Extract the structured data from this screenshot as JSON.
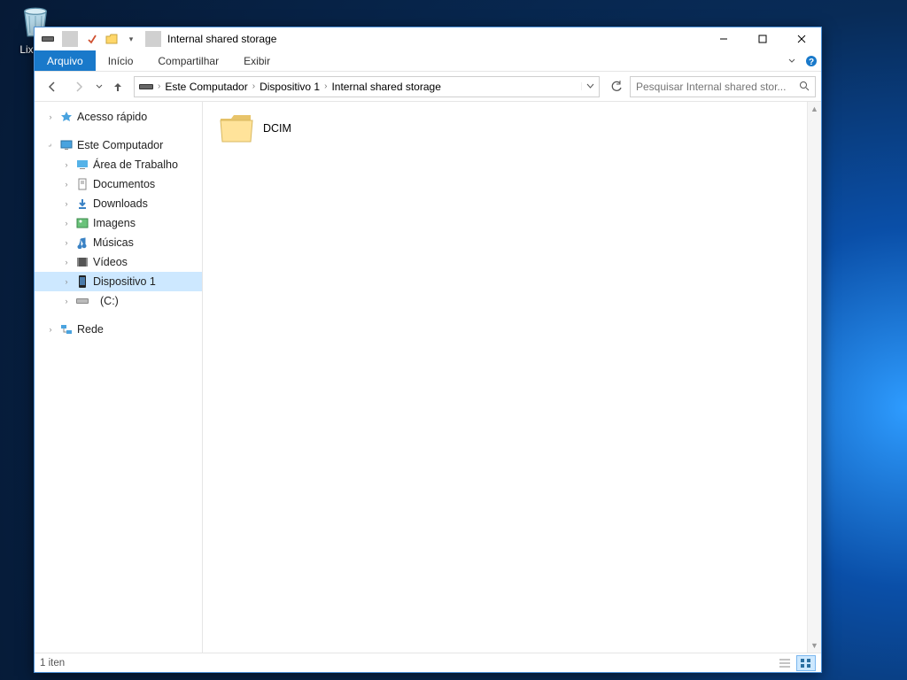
{
  "desktop": {
    "recycle_label": "Lixeira"
  },
  "title": "Internal shared storage",
  "ribbon": {
    "file": "Arquivo",
    "home": "Início",
    "share": "Compartilhar",
    "view": "Exibir"
  },
  "breadcrumb": {
    "root": "Este Computador",
    "dev": "Dispositivo 1",
    "loc": "Internal shared storage"
  },
  "search": {
    "placeholder": "Pesquisar Internal shared stor..."
  },
  "sidebar": {
    "quick": "Acesso rápido",
    "pc": "Este Computador",
    "desktop": "Área de Trabalho",
    "docs": "Documentos",
    "downloads": "Downloads",
    "images": "Imagens",
    "music": "Músicas",
    "videos": "Vídeos",
    "device": "Dispositivo 1",
    "cdrive": "(C:)",
    "network": "Rede"
  },
  "content": {
    "items": [
      {
        "name": "DCIM"
      }
    ]
  },
  "status": {
    "count": "1 iten"
  }
}
